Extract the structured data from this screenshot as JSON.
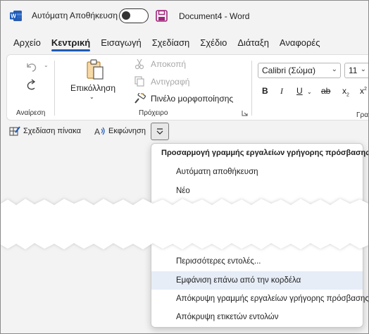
{
  "title_bar": {
    "autosave_label": "Αυτόματη Αποθήκευση",
    "document_title": "Document4 - Word"
  },
  "tabs": [
    {
      "label": "Αρχείο"
    },
    {
      "label": "Κεντρική",
      "active": true
    },
    {
      "label": "Εισαγωγή"
    },
    {
      "label": "Σχεδίαση"
    },
    {
      "label": "Σχέδιο"
    },
    {
      "label": "Διάταξη"
    },
    {
      "label": "Αναφορές"
    }
  ],
  "ribbon": {
    "undo_group_label": "Αναίρεση",
    "paste_label": "Επικόλληση",
    "cut_label": "Αποκοπή",
    "copy_label": "Αντιγραφή",
    "format_painter_label": "Πινέλο μορφοποίησης",
    "clipboard_group_label": "Πρόχειρο",
    "font_name": "Calibri (Σώμα)",
    "font_size": "11",
    "font_group_label_partial": "Γραμ"
  },
  "quick_access": {
    "draw_table_label": "Σχεδίαση πίνακα",
    "dictate_label": "Εκφώνηση"
  },
  "menu": {
    "heading": "Προσαρμογή γραμμής εργαλείων γρήγορης πρόσβασης",
    "items_top": [
      {
        "label": "Αυτόματη αποθήκευση"
      },
      {
        "label": "Νέο"
      }
    ],
    "items_bottom": [
      {
        "label": "Περισσότερες εντολές..."
      },
      {
        "label": "Εμφάνιση επάνω από την κορδέλα",
        "highlighted": true
      },
      {
        "label": "Απόκρυψη γραμμής εργαλείων γρήγορης πρόσβασης"
      },
      {
        "label": "Απόκρυψη ετικετών εντολών"
      }
    ]
  },
  "colors": {
    "word_blue": "#1e5bb5",
    "save_purple": "#a2247c",
    "highlight": "#e6edf7"
  }
}
